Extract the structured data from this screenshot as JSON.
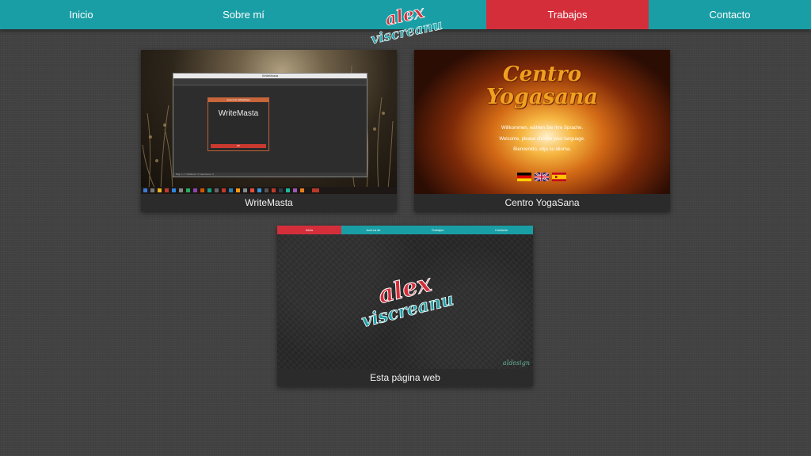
{
  "nav": {
    "items": [
      {
        "label": "Inicio"
      },
      {
        "label": "Sobre mí"
      },
      {
        "label": "Trabajos"
      },
      {
        "label": "Contacto"
      }
    ],
    "logo": {
      "line1": "alex",
      "line2": "viscreanu"
    }
  },
  "colors": {
    "teal": "#1a9ea5",
    "red": "#d42e3b",
    "background": "#424242"
  },
  "works": [
    {
      "caption": "WriteMasta",
      "window_title": "WriteMasta",
      "dialog_title": "WriteMasta",
      "dialog_bar": "Acerca de WriteMasta",
      "dialog_ok": "OK",
      "status_text": "Pág. 1 / 1   Palabras: 0   Caracteres: 0"
    },
    {
      "caption": "Centro YogaSana",
      "title_line1": "Centro",
      "title_line2": "Yogasana",
      "lines": [
        "Willkommen, wählen Sie Ihre Sprache.",
        "Welcome, please choose your language.",
        "Bienvenido, elija su idioma."
      ],
      "flags": [
        "german-flag-icon",
        "uk-flag-icon",
        "spanish-flag-icon"
      ]
    },
    {
      "caption": "Esta página web",
      "nav": [
        "Inicio",
        "Acerca de",
        "Trabajos",
        "Contacto"
      ],
      "logo_line1": "alex",
      "logo_line2": "viscreanu",
      "signature": "aldesign"
    }
  ]
}
